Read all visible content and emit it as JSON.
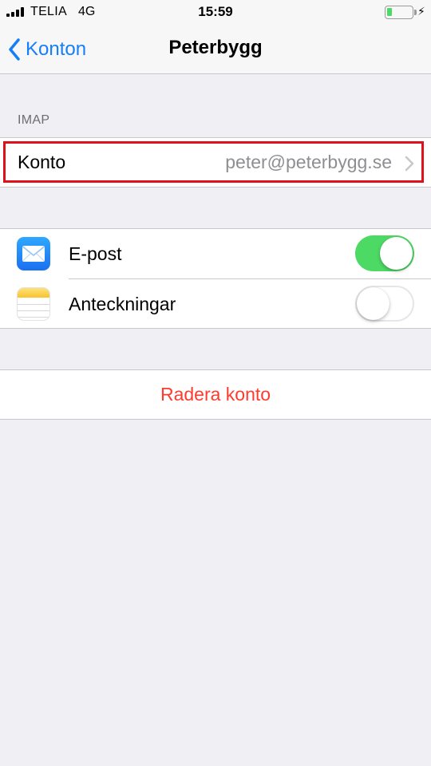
{
  "status_bar": {
    "carrier": "TELIA",
    "network": "4G",
    "time": "15:59",
    "battery_level": 0.2,
    "charging": true
  },
  "nav": {
    "back_label": "Konton",
    "title": "Peterbygg"
  },
  "account_section": {
    "header": "IMAP",
    "row_label": "Konto",
    "row_value": "peter@peterbygg.se"
  },
  "toggles": [
    {
      "label": "E-post",
      "icon": "mail-icon",
      "on": true
    },
    {
      "label": "Anteckningar",
      "icon": "notes-icon",
      "on": false
    }
  ],
  "delete_label": "Radera konto",
  "colors": {
    "accent": "#147efb",
    "destructive": "#ff3b30",
    "switch_on": "#4cd964",
    "highlight": "#e0101b"
  }
}
